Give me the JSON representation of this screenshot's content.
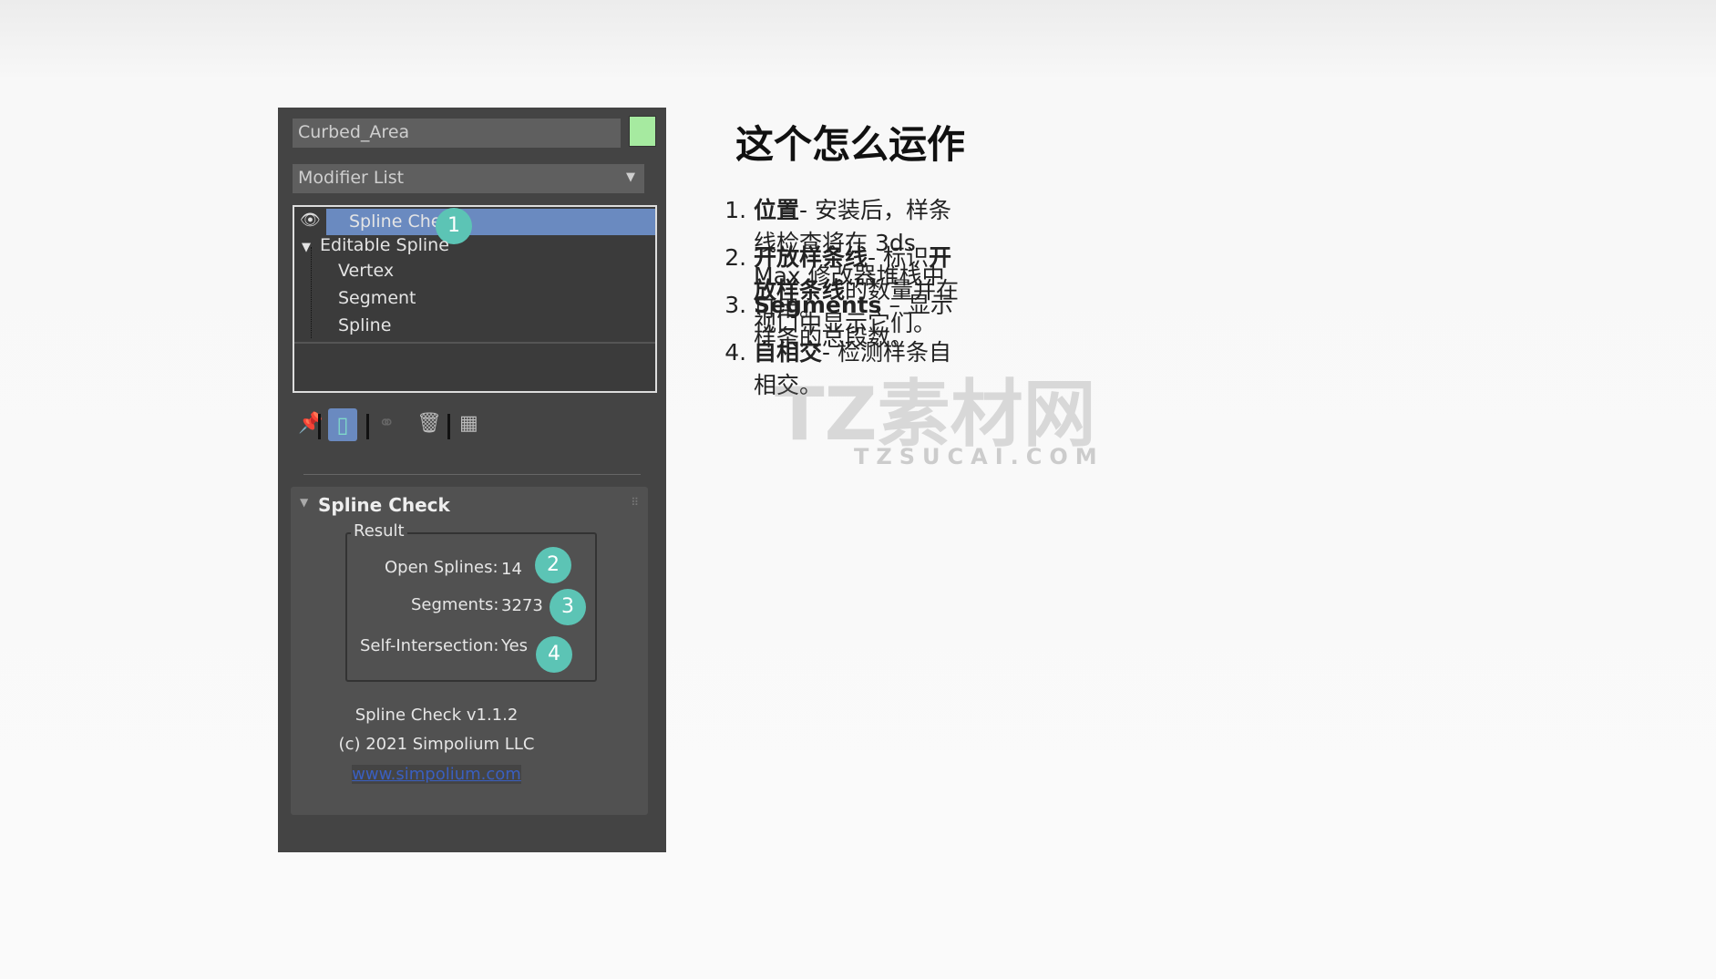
{
  "panel": {
    "object_name": "Curbed_Area",
    "object_color": "#a6eaa0",
    "modifier_list": "Modifier List",
    "stack": [
      "Spline Check",
      "Editable Spline",
      "Vertex",
      "Segment",
      "Spline"
    ],
    "rollout_title": "Spline Check",
    "group_title": "Result",
    "open_splines_label": "Open Splines:",
    "open_splines_value": "14",
    "segments_label": "Segments:",
    "segments_value": "3273",
    "self_intersection_label": "Self-Intersection:",
    "self_intersection_value": "Yes",
    "version": "Spline Check v1.1.2",
    "copyright": "(c) 2021 Simpolium LLC",
    "link": "www.simpolium.com",
    "badges": [
      "1",
      "2",
      "3",
      "4"
    ]
  },
  "right": {
    "title": "这个怎么运作",
    "items": [
      {
        "bold": "位置",
        "text": "- 安装后，样条线检查将在 3ds Max 修改器堆栈中可用。"
      },
      {
        "bold": "开放样条线",
        "text": "- 标识",
        "bold2": "开放样条线",
        "text2": "的数量并在视口中显示它们。"
      },
      {
        "bold": "Segments",
        "text": " – 显示样条的总段数。"
      },
      {
        "bold": "自相交",
        "text": "- 检测样条自相交。"
      }
    ]
  },
  "watermark": {
    "logo": "TZ素材网",
    "url": "TZSUCAI.COM"
  }
}
